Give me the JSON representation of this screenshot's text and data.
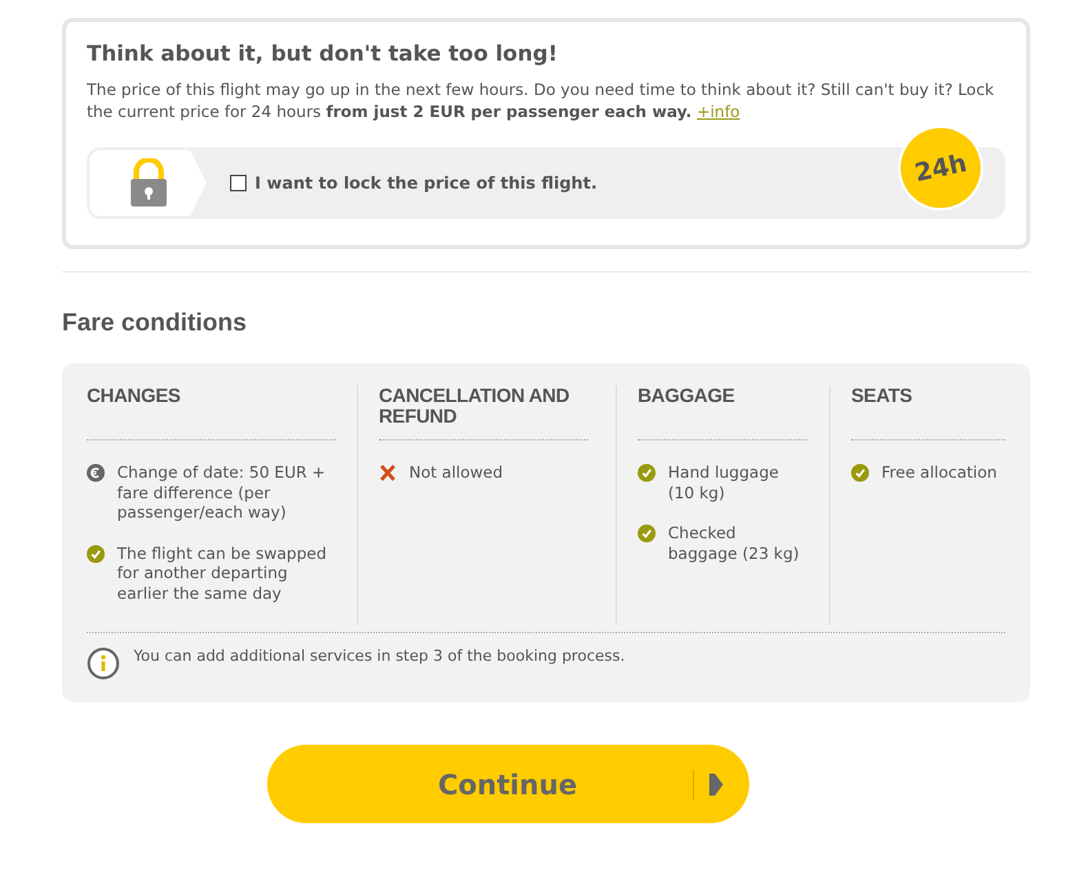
{
  "lock_offer": {
    "title": "Think about it, but don't take too long!",
    "text": "The price of this flight may go up in the next few hours. Do you need time to think about it? Still can't buy it? Lock the current price for 24 hours **from just 2 EUR per passenger each way.**",
    "link": "+info",
    "checkbox": {
      "label": "I want to lock the price of this flight.",
      "checked": false
    },
    "badge": "24h"
  },
  "fare_conditions": {
    "title": "Fare conditions",
    "columns": [
      {
        "heading": "CHANGES",
        "items": [
          {
            "kind": "euro",
            "text": "Change of date: 50 EUR + fare difference (per passenger/each way)"
          },
          {
            "kind": "check",
            "text": "The flight can be swapped for another departing earlier the same day"
          }
        ]
      },
      {
        "heading": "CANCELLATION AND REFUND",
        "items": [
          {
            "kind": "cross",
            "text": "Not allowed"
          }
        ]
      },
      {
        "heading": "BAGGAGE",
        "items": [
          {
            "kind": "check",
            "text": "Hand luggage (10 kg)"
          },
          {
            "kind": "check",
            "text": "Checked baggage (23 kg)"
          }
        ]
      },
      {
        "heading": "SEATS",
        "items": [
          {
            "kind": "check",
            "text": "Free allocation"
          }
        ]
      }
    ],
    "note": "You can add additional services in step 3 of the booking process."
  },
  "continue_button": "Continue"
}
